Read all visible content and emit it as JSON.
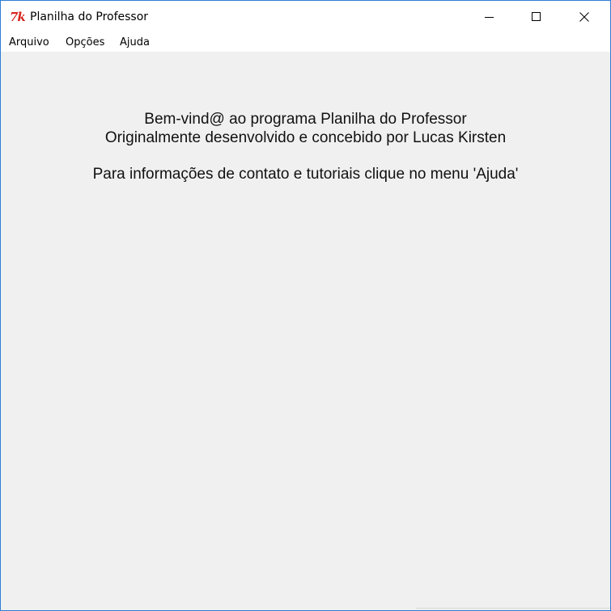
{
  "window": {
    "title": "Planilha do Professor",
    "icon": "tk-feather-icon",
    "controls": {
      "minimize": "minimize-icon",
      "maximize": "maximize-icon",
      "close": "close-icon"
    },
    "border_color": "#2b7fd4"
  },
  "menubar": {
    "items": [
      {
        "label": "Arquivo"
      },
      {
        "label": "Opções"
      },
      {
        "label": "Ajuda"
      }
    ]
  },
  "main": {
    "welcome_line": "Bem-vind@ ao programa Planilha do Professor",
    "author_line": "Originalmente desenvolvido e concebido por Lucas Kirsten",
    "help_line": "Para informações de contato e tutoriais clique no menu 'Ajuda'"
  },
  "colors": {
    "background": "#f0f0f0",
    "titlebar": "#ffffff",
    "icon_red": "#d8231b"
  }
}
